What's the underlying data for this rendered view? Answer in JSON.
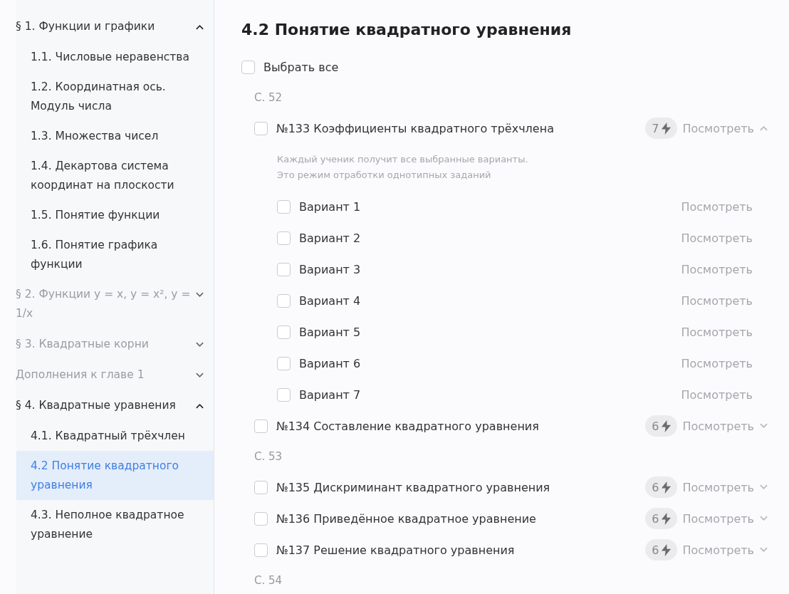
{
  "sidebar": {
    "sections": [
      {
        "title": "§ 1. Функции и графики",
        "expanded": true,
        "children": [
          {
            "label": "1.1. Числовые неравенства",
            "selected": false
          },
          {
            "label": "1.2. Координатная ось. Модуль числа",
            "selected": false
          },
          {
            "label": "1.3. Множества чисел",
            "selected": false
          },
          {
            "label": "1.4. Декартова система координат на плоскости",
            "selected": false
          },
          {
            "label": "1.5. Понятие функции",
            "selected": false
          },
          {
            "label": "1.6. Понятие графика функции",
            "selected": false
          }
        ]
      },
      {
        "title": "§ 2. Функции y = x, y = x², y = 1/x",
        "expanded": false
      },
      {
        "title": "§ 3. Квадратные корни",
        "expanded": false
      },
      {
        "title": "Дополнения к главе 1",
        "expanded": false
      },
      {
        "title": "§ 4. Квадратные уравнения",
        "expanded": true,
        "children": [
          {
            "label": "4.1. Квадратный трёхчлен",
            "selected": false
          },
          {
            "label": "4.2 Понятие квадратного уравнения",
            "selected": true
          },
          {
            "label": "4.3. Неполное квадратное уравнение",
            "selected": false
          }
        ]
      }
    ]
  },
  "main": {
    "title": "4.2 Понятие квадратного уравнения",
    "select_all": {
      "label": "Выбрать все",
      "checked": false
    },
    "groups": [
      {
        "page": "С. 52",
        "tasks": [
          {
            "title": "№133 Коэффициенты квадратного трёхчлена",
            "checked": false,
            "count": "7",
            "view_label": "Посмотреть",
            "expanded": true,
            "hint": "Каждый ученик получит все выбранные варианты.\nЭто режим отработки однотипных заданий",
            "variants": [
              {
                "label": "Вариант 1",
                "checked": false,
                "view_label": "Посмотреть"
              },
              {
                "label": "Вариант 2",
                "checked": false,
                "view_label": "Посмотреть"
              },
              {
                "label": "Вариант 3",
                "checked": false,
                "view_label": "Посмотреть"
              },
              {
                "label": "Вариант 4",
                "checked": false,
                "view_label": "Посмотреть"
              },
              {
                "label": "Вариант 5",
                "checked": false,
                "view_label": "Посмотреть"
              },
              {
                "label": "Вариант 6",
                "checked": false,
                "view_label": "Посмотреть"
              },
              {
                "label": "Вариант 7",
                "checked": false,
                "view_label": "Посмотреть"
              }
            ]
          },
          {
            "title": "№134 Составление квадратного уравнения",
            "checked": false,
            "count": "6",
            "view_label": "Посмотреть",
            "expanded": false
          }
        ]
      },
      {
        "page": "С. 53",
        "tasks": [
          {
            "title": "№135 Дискриминант квадратного уравнения",
            "checked": false,
            "count": "6",
            "view_label": "Посмотреть",
            "expanded": false
          },
          {
            "title": "№136 Приведённое квадратное уравнение",
            "checked": false,
            "count": "6",
            "view_label": "Посмотреть",
            "expanded": false
          },
          {
            "title": "№137 Решение квадратного уравнения",
            "checked": false,
            "count": "6",
            "view_label": "Посмотреть",
            "expanded": false
          }
        ]
      },
      {
        "page": "С. 54"
      }
    ]
  }
}
